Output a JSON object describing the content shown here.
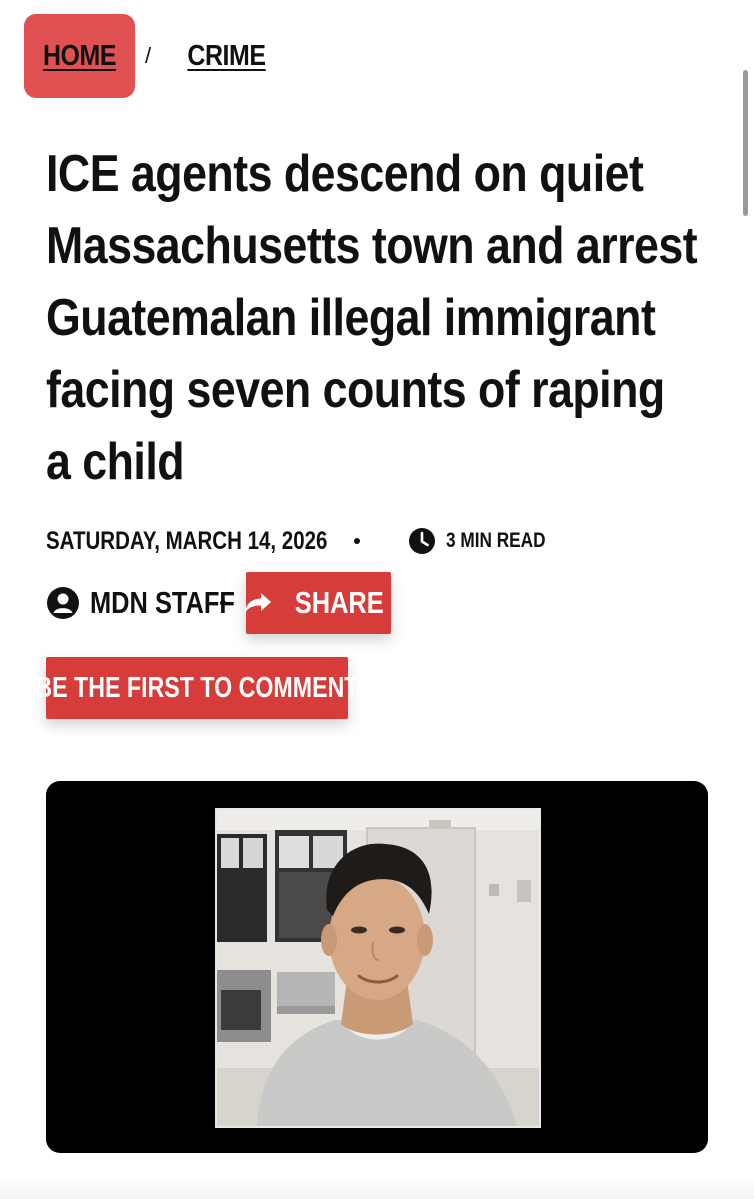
{
  "breadcrumb": {
    "home_label": "HOME",
    "separator": "/",
    "category_label": "CRIME"
  },
  "article": {
    "title": "ICE agents descend on quiet Massachusetts town and arrest Guatemalan illegal immigrant facing seven counts of raping a child",
    "date": "SATURDAY, MARCH 14, 2026",
    "read_time": "3 MIN READ",
    "author": "MDN STAFF",
    "share_label": "SHARE",
    "comment_label": "BE THE FIRST TO COMMENT"
  },
  "colors": {
    "accent_red": "#d63d3a",
    "home_pill": "#e05252",
    "media_background": "#000000"
  },
  "icons": {
    "clock": "clock-icon",
    "user": "user-circle-icon",
    "share": "share-arrow-icon"
  }
}
